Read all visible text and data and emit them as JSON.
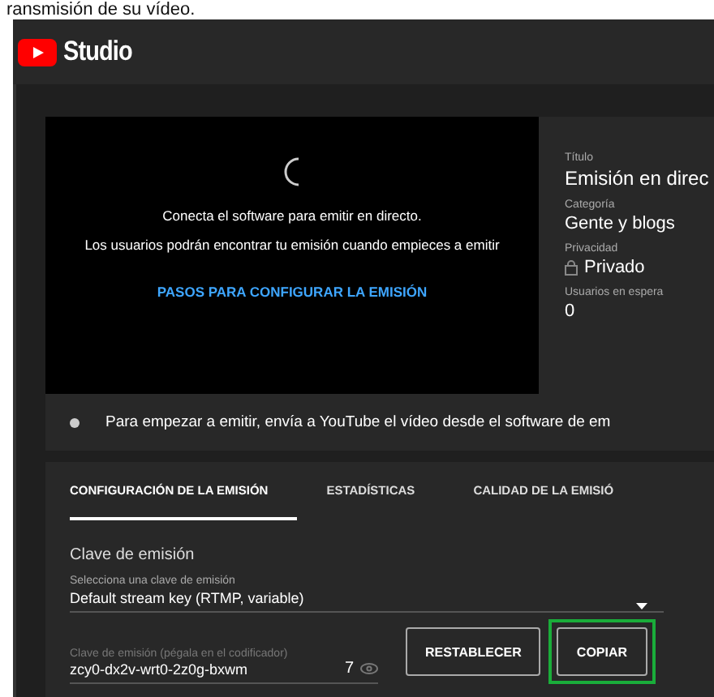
{
  "page_heading": "ransmisión de su vídeo.",
  "header": {
    "brand": "Studio"
  },
  "preview": {
    "message": "Conecta el software para emitir en directo.",
    "note": "Los usuarios podrán encontrar tu emisión cuando empieces a emitir",
    "link": "PASOS PARA CONFIGURAR LA EMISIÓN"
  },
  "details": [
    {
      "label": "Título",
      "value": "Emisión en direc"
    },
    {
      "label": "Categoría",
      "value": "Gente y blogs"
    },
    {
      "label": "Privacidad",
      "value": "Privado",
      "kind": "lock"
    },
    {
      "label": "Usuarios en espera",
      "value": "0"
    }
  ],
  "status": {
    "message": "Para empezar a emitir, envía a YouTube el vídeo desde el software de em"
  },
  "tabs": [
    {
      "label": "CONFIGURACIÓN DE LA EMISIÓN",
      "selected": true
    },
    {
      "label": "ESTADÍSTICAS",
      "selected": false
    },
    {
      "label": "CALIDAD DE LA EMISIÓ",
      "selected": false
    }
  ],
  "stream_key": {
    "section_title": "Clave de emisión",
    "select_label": "Selecciona una clave de emisión",
    "select_value": "Default stream key (RTMP, variable)",
    "key_label": "Clave de emisión (pégala en el codificador)",
    "key_value": "zcy0-dx2v-wrt0-2z0g-bxwm",
    "key_count": "7"
  },
  "buttons": [
    {
      "label": "RESTABLECER",
      "highlighted": false
    },
    {
      "label": "COPIAR",
      "highlighted": true
    }
  ]
}
